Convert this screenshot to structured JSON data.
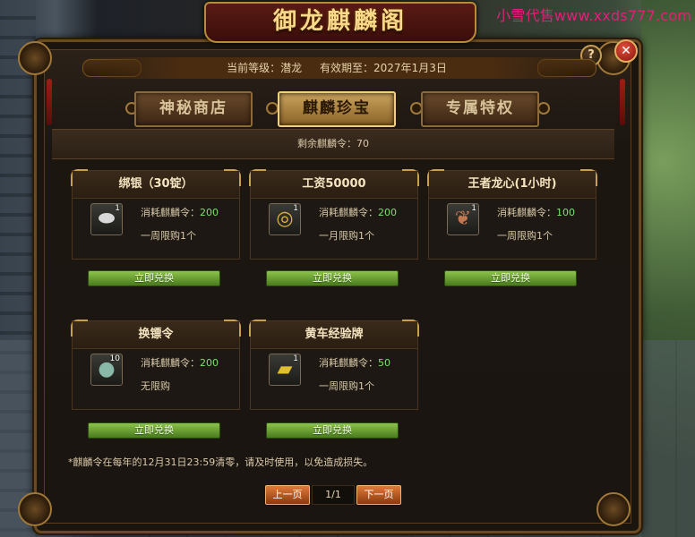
{
  "watermark": "小雪代售www.xxds777.com",
  "window": {
    "title": "御龙麒麟阁",
    "help_glyph": "?",
    "close_glyph": "✕"
  },
  "info": {
    "level_label": "当前等级：潜龙",
    "expiry_label": "有效期至：2027年1月3日"
  },
  "tabs": [
    {
      "label": "神秘商店",
      "active": false
    },
    {
      "label": "麒麟珍宝",
      "active": true
    },
    {
      "label": "专属特权",
      "active": false
    }
  ],
  "remaining": "剩余麒麟令：70",
  "items": [
    {
      "title": "绑银（30锭）",
      "icon": "silver-ingot-icon",
      "count": "1",
      "cost_label": "消耗麒麟令：",
      "cost": "200",
      "limit": "一周限购1个",
      "button": "立即兑换"
    },
    {
      "title": "工资50000",
      "icon": "gold-coins-icon",
      "count": "1",
      "cost_label": "消耗麒麟令：",
      "cost": "200",
      "limit": "一月限购1个",
      "button": "立即兑换"
    },
    {
      "title": "王者龙心(1小时)",
      "icon": "dragon-heart-icon",
      "count": "1",
      "cost_label": "消耗麒麟令：",
      "cost": "100",
      "limit": "一周限购1个",
      "button": "立即兑换"
    },
    {
      "title": "换镖令",
      "icon": "escort-token-icon",
      "count": "10",
      "cost_label": "消耗麒麟令：",
      "cost": "200",
      "limit": "无限购",
      "button": "立即兑换"
    },
    {
      "title": "黄车经验牌",
      "icon": "yellow-cart-icon",
      "count": "1",
      "cost_label": "消耗麒麟令：",
      "cost": "50",
      "limit": "一周限购1个",
      "button": "立即兑换"
    }
  ],
  "footnote": "*麒麟令在每年的12月31日23:59清零，请及时使用，以免造成损失。",
  "pager": {
    "prev": "上一页",
    "page": "1/1",
    "next": "下一页"
  }
}
